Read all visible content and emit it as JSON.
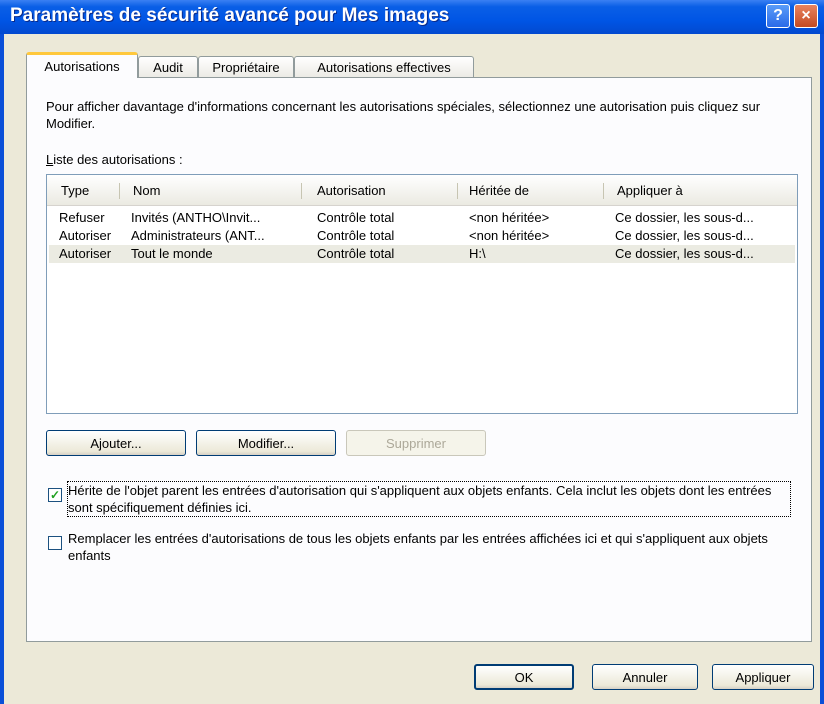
{
  "window": {
    "title": "Paramètres de sécurité avancé pour Mes images",
    "help": "?",
    "close": "×"
  },
  "tabs": [
    {
      "label": "Autorisations"
    },
    {
      "label": "Audit"
    },
    {
      "label": "Propriétaire"
    },
    {
      "label": "Autorisations effectives"
    }
  ],
  "permissions": {
    "description": "Pour afficher davantage d'informations concernant les autorisations spéciales, sélectionnez une autorisation puis cliquez sur Modifier.",
    "list_label_accel": "L",
    "list_label_rest": "iste des autorisations :",
    "columns": [
      "Type",
      "Nom",
      "Autorisation",
      "Héritée de",
      "Appliquer à"
    ],
    "rows": [
      {
        "type": "Refuser",
        "name": "Invités (ANTHO\\Invit...",
        "permission": "Contrôle total",
        "inherited_from": "<non héritée>",
        "applies_to": "Ce dossier, les sous-d..."
      },
      {
        "type": "Autoriser",
        "name": "Administrateurs (ANT...",
        "permission": "Contrôle total",
        "inherited_from": "<non héritée>",
        "applies_to": "Ce dossier, les sous-d..."
      },
      {
        "type": "Autoriser",
        "name": "Tout le monde",
        "permission": "Contrôle total",
        "inherited_from": "H:\\",
        "applies_to": "Ce dossier, les sous-d..."
      }
    ],
    "selected_row": 2,
    "buttons": {
      "add": "Ajouter...",
      "edit": "Modifier...",
      "remove": "Supprimer"
    },
    "inherit_label": "Hérite de l'objet parent les entrées d'autorisation qui s'appliquent aux objets enfants. Cela inclut les objets dont les entrées sont spécifiquement définies ici.",
    "inherit_checked": true,
    "replace_label": "Remplacer les entrées d'autorisations de tous les objets enfants par les entrées affichées ici et qui s'appliquent aux objets enfants",
    "replace_checked": false
  },
  "footer": {
    "ok": "OK",
    "cancel": "Annuler",
    "apply": "Appliquer"
  },
  "colors": {
    "titlebar": "#0055e5",
    "tab_accent": "#ffc83c",
    "dialog_bg": "#ece9d8",
    "selected_row": "#ebebe2",
    "check": "#21a121"
  }
}
